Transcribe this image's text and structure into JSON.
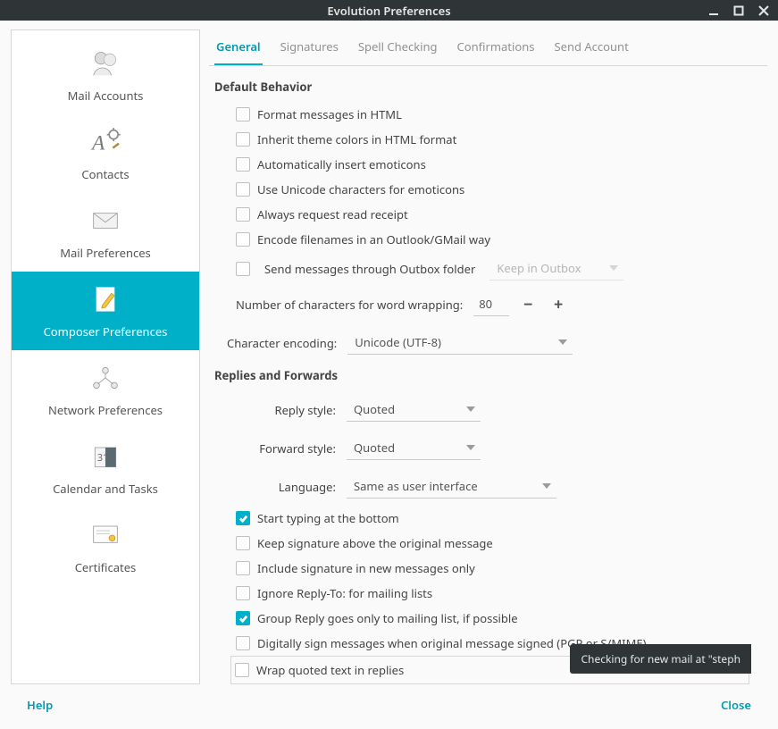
{
  "window": {
    "title": "Evolution Preferences"
  },
  "tabs": {
    "general": "General",
    "signatures": "Signatures",
    "spell": "Spell Checking",
    "confirm": "Confirmations",
    "send": "Send Account"
  },
  "sidebar": {
    "mail_accounts": "Mail Accounts",
    "contacts": "Contacts",
    "mail_prefs": "Mail Preferences",
    "composer": "Composer Preferences",
    "network": "Network Preferences",
    "calendar": "Calendar and Tasks",
    "certs": "Certificates"
  },
  "default_behavior": {
    "title": "Default Behavior",
    "format_html": "Format messages in HTML",
    "inherit_theme": "Inherit theme colors in HTML format",
    "auto_emoticons": "Automatically insert emoticons",
    "unicode_emoticons": "Use Unicode characters for emoticons",
    "read_receipt": "Always request read receipt",
    "encode_filenames": "Encode filenames in an Outlook/GMail way",
    "through_outbox": "Send messages through Outbox folder",
    "keep_in_outbox": "Keep in Outbox",
    "wrap_label": "Number of characters for word wrapping:",
    "wrap_value": "80",
    "encoding_label": "Character encoding:",
    "encoding_value": "Unicode (UTF-8)"
  },
  "replies": {
    "title": "Replies and Forwards",
    "reply_style_label": "Reply style:",
    "reply_style_value": "Quoted",
    "forward_style_label": "Forward style:",
    "forward_style_value": "Quoted",
    "language_label": "Language:",
    "language_value": "Same as user interface",
    "typing_bottom": "Start typing at the bottom",
    "sig_above": "Keep signature above the original message",
    "sig_new_only": "Include signature in new messages only",
    "ignore_replyto": "Ignore Reply-To: for mailing lists",
    "group_reply": "Group Reply goes only to mailing list, if possible",
    "digital_sign": "Digitally sign messages when original message signed (PGP or S/MIME)",
    "wrap_quoted": "Wrap quoted text in replies"
  },
  "footer": {
    "help": "Help",
    "close": "Close"
  },
  "notification": "Checking for new mail at \"steph"
}
